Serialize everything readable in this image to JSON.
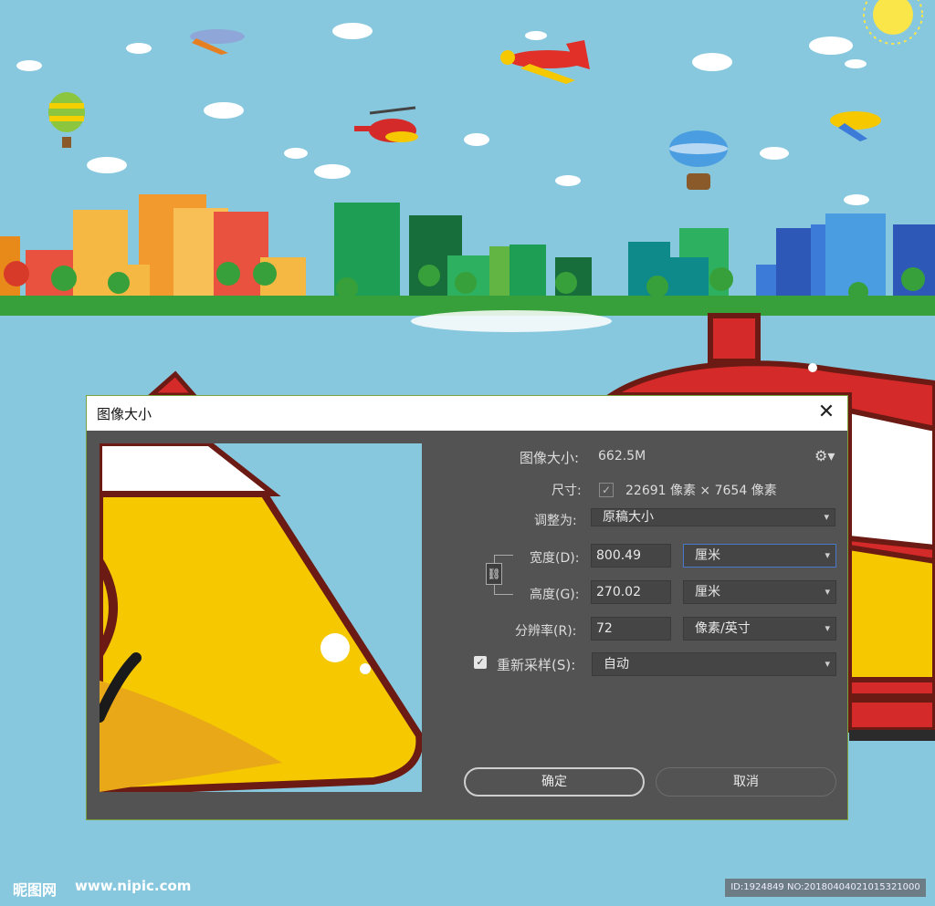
{
  "dialog": {
    "title": "图像大小",
    "close_icon": "close-icon",
    "image_size_label": "图像大小:",
    "image_size_value": "662.5M",
    "gear_icon": "gear-icon",
    "dimensions_label": "尺寸:",
    "dimensions_value": "22691 像素  ×  7654 像素",
    "fit_to_label": "调整为:",
    "fit_to_value": "原稿大小",
    "width_label": "宽度(D):",
    "width_value": "800.49",
    "width_unit": "厘米",
    "height_label": "高度(G):",
    "height_value": "270.02",
    "height_unit": "厘米",
    "resolution_label": "分辨率(R):",
    "resolution_value": "72",
    "resolution_unit": "像素/英寸",
    "resample_label": "重新采样(S):",
    "resample_checked": true,
    "resample_value": "自动",
    "ok_label": "确定",
    "cancel_label": "取消"
  },
  "footer": {
    "logo_text": "昵图网",
    "site": "www.nipic.com",
    "id_text": "ID:1924849 NO:20180404021015321000"
  },
  "colors": {
    "sky": "#87c8de",
    "dialog_bg": "#535353",
    "field_bg": "#454545",
    "focus_border": "#4a78c8"
  }
}
